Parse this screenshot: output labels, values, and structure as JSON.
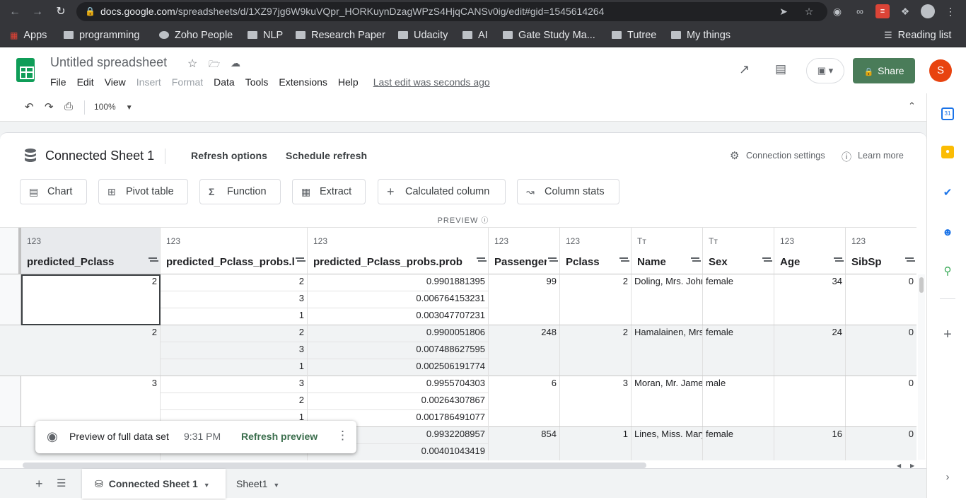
{
  "browser": {
    "url_host": "docs.google.com",
    "url_path": "/spreadsheets/d/1XZ97jg6W9kuVQpr_HORKuynDzagWPzS4HjqCANSv0ig/edit#gid=1545614264",
    "bookmarks": [
      "Apps",
      "programming",
      "Zoho People",
      "NLP",
      "Research Paper",
      "Udacity",
      "AI",
      "Gate Study Ma...",
      "Tutree",
      "My things"
    ],
    "reading_list": "Reading list"
  },
  "doc": {
    "title": "Untitled spreadsheet",
    "menu": [
      "File",
      "Edit",
      "View",
      "Insert",
      "Format",
      "Data",
      "Tools",
      "Extensions",
      "Help"
    ],
    "last_edit": "Last edit was seconds ago",
    "share_label": "Share",
    "avatar_letter": "S"
  },
  "toolbar": {
    "zoom": "100%"
  },
  "connected": {
    "title": "Connected Sheet 1",
    "refresh_options": "Refresh options",
    "schedule_refresh": "Schedule refresh",
    "connection_settings": "Connection settings",
    "learn_more": "Learn more",
    "actions": [
      "Chart",
      "Pivot table",
      "Function",
      "Extract",
      "Calculated column",
      "Column stats"
    ],
    "preview_label": "PREVIEW"
  },
  "grid": {
    "columns": [
      {
        "type": "123",
        "name": "predicted_Pclass"
      },
      {
        "type": "123",
        "name": "predicted_Pclass_probs.la"
      },
      {
        "type": "123",
        "name": "predicted_Pclass_probs.prob"
      },
      {
        "type": "123",
        "name": "PassengerId"
      },
      {
        "type": "123",
        "name": "Pclass"
      },
      {
        "type": "Tт",
        "name": "Name"
      },
      {
        "type": "Tт",
        "name": "Sex"
      },
      {
        "type": "123",
        "name": "Age"
      },
      {
        "type": "123",
        "name": "SibSp"
      }
    ],
    "rows": [
      {
        "pclass": "2",
        "labels": [
          "2",
          "3",
          "1"
        ],
        "probs": [
          "0.9901881395",
          "0.006764153231",
          "0.003047707231"
        ],
        "pid": "99",
        "pc": "2",
        "name": "Doling, Mrs. John",
        "sex": "female",
        "age": "34",
        "sibsp": "0"
      },
      {
        "pclass": "2",
        "labels": [
          "2",
          "3",
          "1"
        ],
        "probs": [
          "0.9900051806",
          "0.007488627595",
          "0.002506191774"
        ],
        "pid": "248",
        "pc": "2",
        "name": "Hamalainen, Mrs.",
        "sex": "female",
        "age": "24",
        "sibsp": "0"
      },
      {
        "pclass": "3",
        "labels": [
          "3",
          "2",
          "1"
        ],
        "probs": [
          "0.9955704303",
          "0.00264307867",
          "0.001786491077"
        ],
        "pid": "6",
        "pc": "3",
        "name": "Moran, Mr. James",
        "sex": "male",
        "age": "",
        "sibsp": "0"
      },
      {
        "pclass": "",
        "labels": [
          "",
          "",
          ""
        ],
        "probs": [
          "0.9932208957",
          "0.00401043419",
          ""
        ],
        "pid": "854",
        "pc": "1",
        "name": "Lines, Miss. Mary",
        "sex": "female",
        "age": "16",
        "sibsp": "0"
      }
    ]
  },
  "toast": {
    "text": "Preview of full data set",
    "time": "9:31 PM",
    "action": "Refresh preview"
  },
  "sheets": [
    "Connected Sheet 1",
    "Sheet1"
  ]
}
